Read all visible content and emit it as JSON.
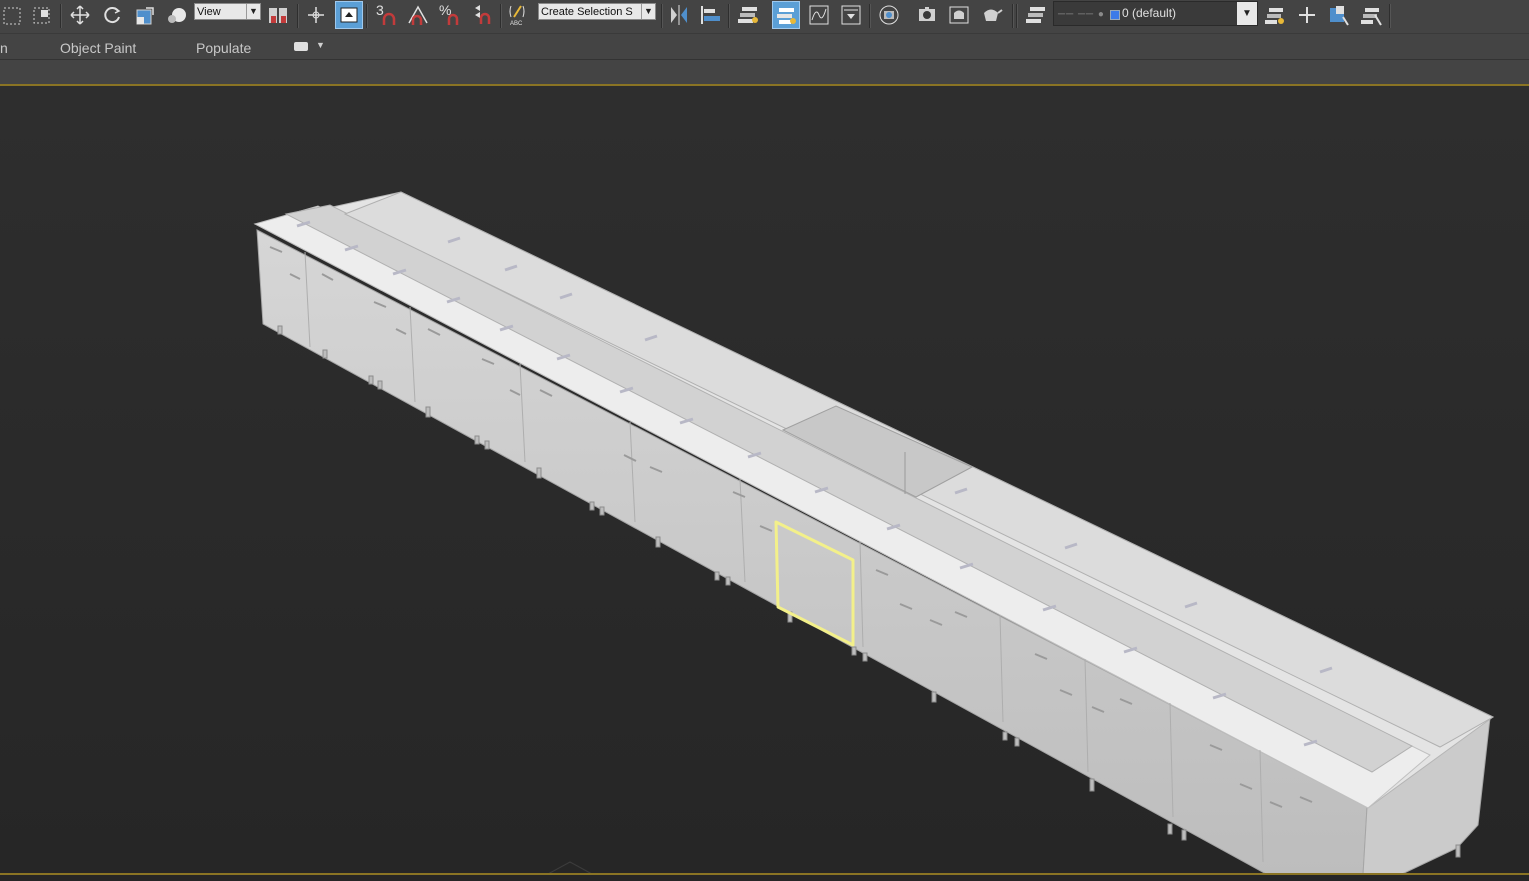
{
  "toolbar": {
    "view_dropdown": "View",
    "selection_set_dropdown": "Create Selection S",
    "snap_3_label": "3",
    "percent_snap_label": "%",
    "layer_dropdown": "0 (default)",
    "accent_color": "#5b9fd6"
  },
  "ribbon": {
    "tabs": [
      "n",
      "Object Paint",
      "Populate"
    ]
  },
  "viewport": {
    "selection_color": "#f3f08a",
    "model_color": "#d9d9d9"
  }
}
